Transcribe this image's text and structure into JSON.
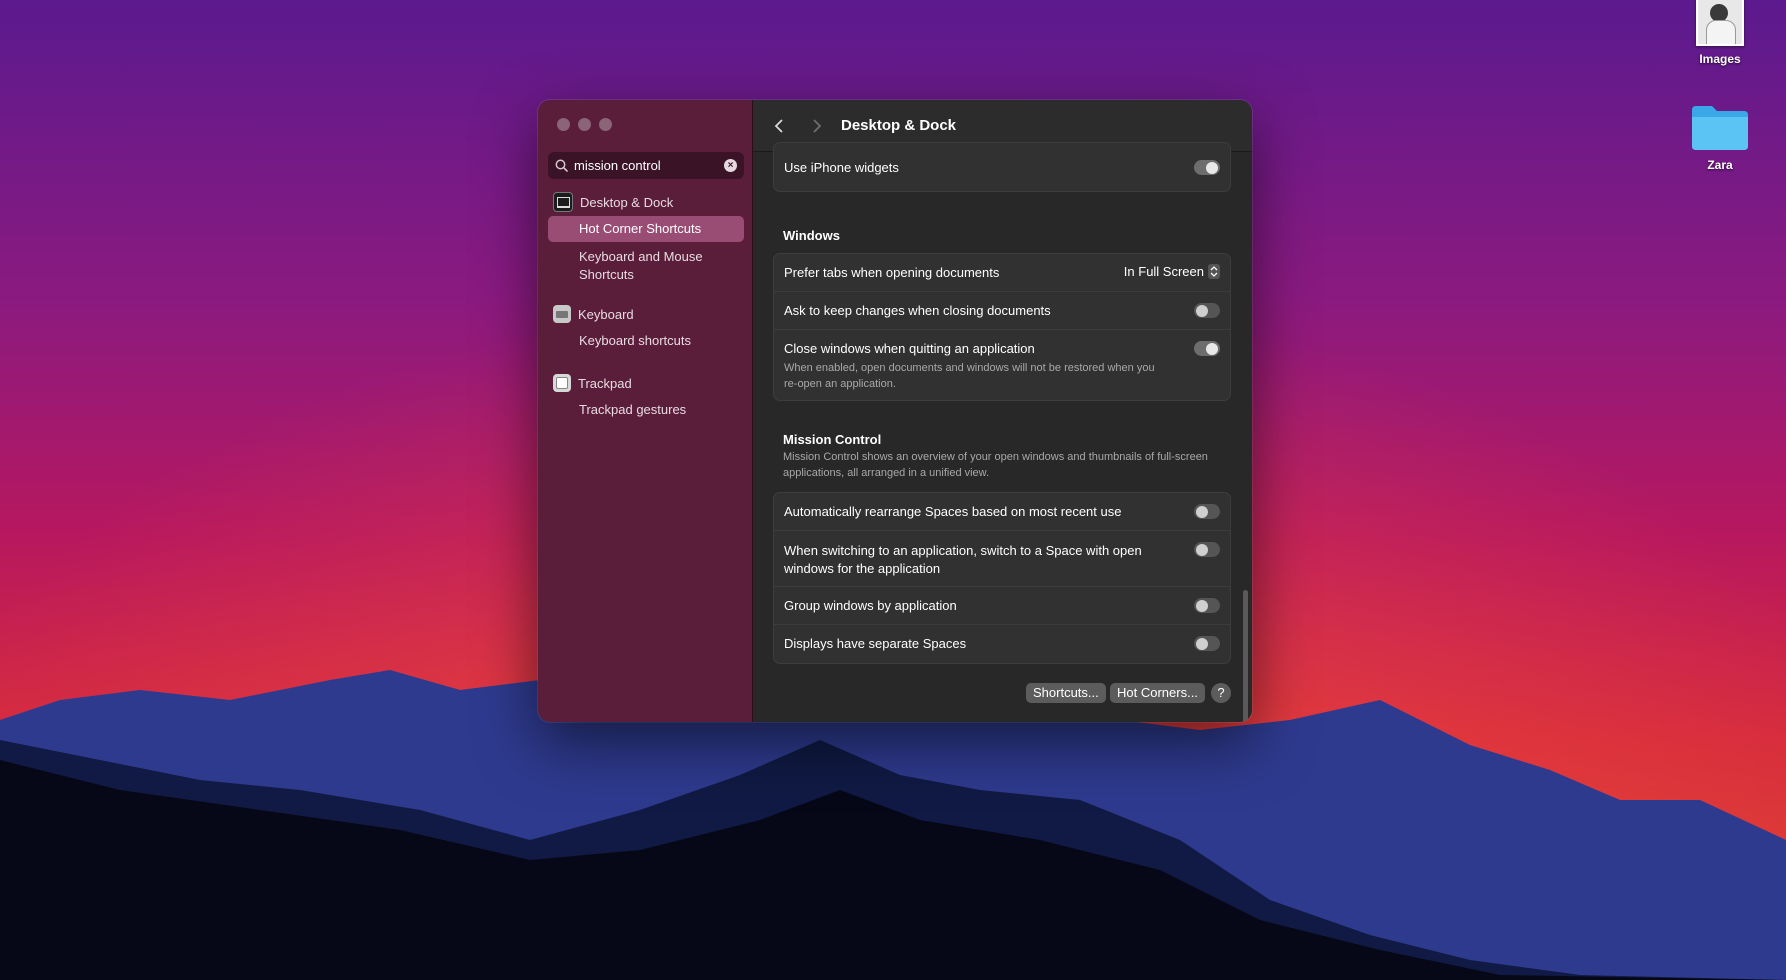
{
  "desktop": {
    "icons": [
      {
        "label": "Images"
      },
      {
        "label": "Zara"
      }
    ]
  },
  "window": {
    "search": {
      "value": "mission control"
    },
    "sidebar": {
      "groups": [
        {
          "label": "Desktop & Dock",
          "subs": [
            "Hot Corner Shortcuts",
            "Keyboard and Mouse Shortcuts"
          ]
        },
        {
          "label": "Keyboard",
          "subs": [
            "Keyboard shortcuts"
          ]
        },
        {
          "label": "Trackpad",
          "subs": [
            "Trackpad gestures"
          ]
        }
      ],
      "selected": "Hot Corner Shortcuts"
    },
    "title": "Desktop & Dock",
    "widgets_card": {
      "rows": [
        {
          "label": "Use iPhone widgets",
          "on": true
        }
      ]
    },
    "windows_section": {
      "title": "Windows",
      "rows": [
        {
          "label": "Prefer tabs when opening documents",
          "value": "In Full Screen"
        },
        {
          "label": "Ask to keep changes when closing documents",
          "on": false
        },
        {
          "label": "Close windows when quitting an application",
          "on": true,
          "desc": "When enabled, open documents and windows will not be restored when you re-open an application."
        }
      ]
    },
    "mission_control": {
      "title": "Mission Control",
      "desc": "Mission Control shows an overview of your open windows and thumbnails of full-screen applications, all arranged in a unified view.",
      "rows": [
        {
          "label": "Automatically rearrange Spaces based on most recent use",
          "on": false
        },
        {
          "label": "When switching to an application, switch to a Space with open windows for the application",
          "on": false
        },
        {
          "label": "Group windows by application",
          "on": false
        },
        {
          "label": "Displays have separate Spaces",
          "on": false
        }
      ]
    },
    "buttons": {
      "shortcuts": "Shortcuts...",
      "hot_corners": "Hot Corners...",
      "help": "?"
    }
  }
}
